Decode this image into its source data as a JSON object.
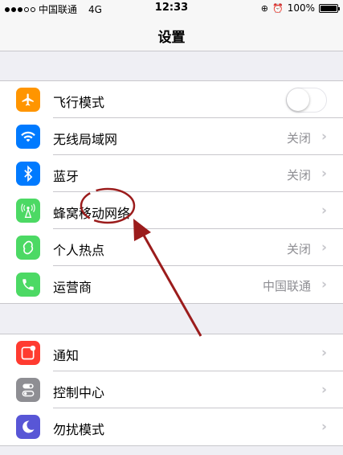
{
  "status_bar": {
    "carrier": "中国联通",
    "network": "4G",
    "time": "12:33",
    "battery": "100%"
  },
  "nav": {
    "title": "设置"
  },
  "group1": [
    {
      "label": "飞行模式",
      "icon": "airplane-icon",
      "icon_color": "#ff9500",
      "toggle": true,
      "toggle_on": false
    },
    {
      "label": "无线局域网",
      "icon": "wifi-icon",
      "icon_color": "#007aff",
      "value": "关闭"
    },
    {
      "label": "蓝牙",
      "icon": "bluetooth-icon",
      "icon_color": "#007aff",
      "value": "关闭"
    },
    {
      "label": "蜂窝移动网络",
      "icon": "cellular-icon",
      "icon_color": "#4cd964"
    },
    {
      "label": "个人热点",
      "icon": "hotspot-icon",
      "icon_color": "#4cd964",
      "value": "关闭"
    },
    {
      "label": "运营商",
      "icon": "phone-icon",
      "icon_color": "#4cd964",
      "value": "中国联通"
    }
  ],
  "group2": [
    {
      "label": "通知",
      "icon": "notifications-icon",
      "icon_color": "#ff3b30"
    },
    {
      "label": "控制中心",
      "icon": "control-center-icon",
      "icon_color": "#8e8e93"
    },
    {
      "label": "勿扰模式",
      "icon": "moon-icon",
      "icon_color": "#5856d6"
    }
  ],
  "annotation_color": "#9b1c1c"
}
